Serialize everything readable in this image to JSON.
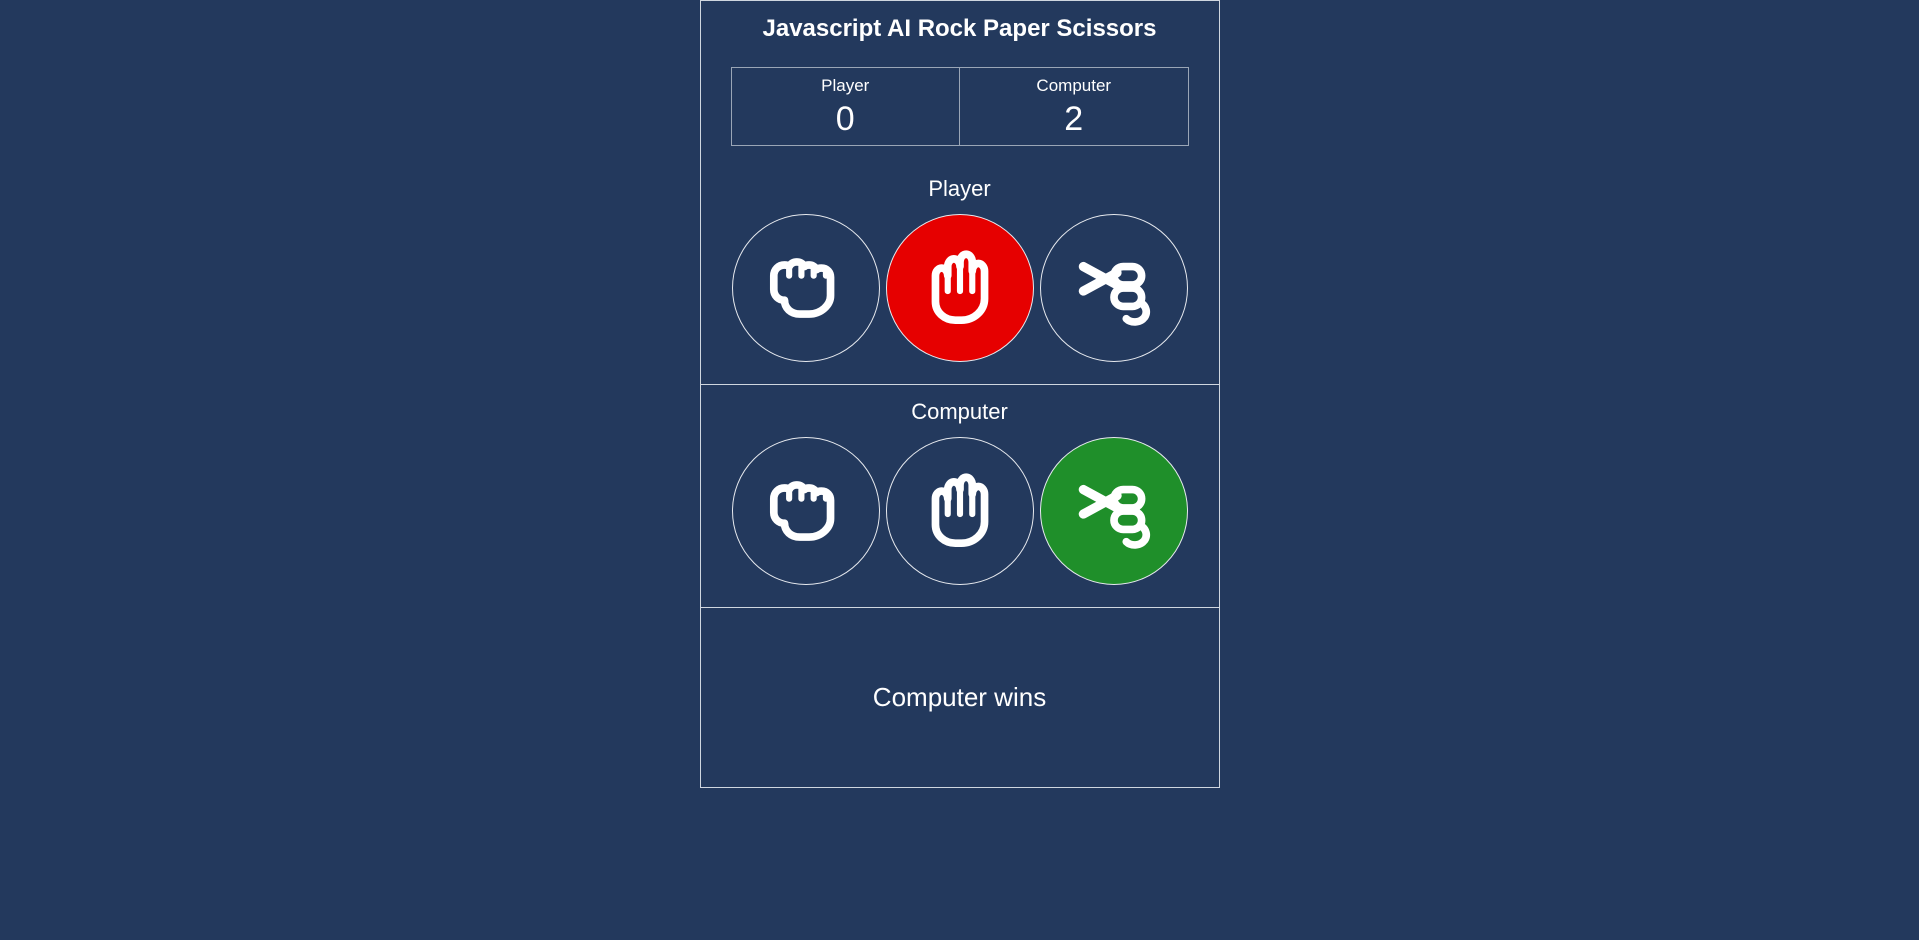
{
  "title": "Javascript AI Rock Paper Scissors",
  "score": {
    "player_label": "Player",
    "computer_label": "Computer",
    "player_value": "0",
    "computer_value": "2"
  },
  "player": {
    "label": "Player",
    "choices": [
      "rock",
      "paper",
      "scissors"
    ],
    "selected": "paper",
    "outcome": "lose"
  },
  "computer": {
    "label": "Computer",
    "choices": [
      "rock",
      "paper",
      "scissors"
    ],
    "selected": "scissors",
    "outcome": "win"
  },
  "result_text": "Computer wins"
}
